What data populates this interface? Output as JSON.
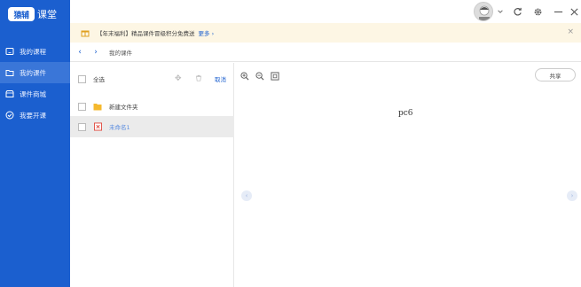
{
  "app": {
    "logo_mark": "猿辅",
    "logo_text": "课堂"
  },
  "sidebar": {
    "items": [
      {
        "label": "我的课程",
        "icon": "tablet-icon",
        "active": false
      },
      {
        "label": "我的课件",
        "icon": "folder-icon",
        "active": true
      },
      {
        "label": "课件商城",
        "icon": "shop-icon",
        "active": false
      },
      {
        "label": "我要开课",
        "icon": "check-circle-icon",
        "active": false
      }
    ]
  },
  "notice": {
    "text": "【年末福利】精品课件冒级积分免费送",
    "more": "更多",
    "close": "×"
  },
  "breadcrumb": {
    "path": "我的课件"
  },
  "file_list": {
    "select_all": "全选",
    "cancel": "取消",
    "items": [
      {
        "name": "新建文件夹",
        "type": "folder",
        "selected": false
      },
      {
        "name": "未命名1",
        "type": "courseware",
        "selected": true
      }
    ]
  },
  "preview": {
    "share": "共享",
    "page_label": "pc6"
  },
  "colors": {
    "brand": "#1b5fcf",
    "notice_bg": "#fdf6e4",
    "selected_row": "#ebebeb"
  }
}
